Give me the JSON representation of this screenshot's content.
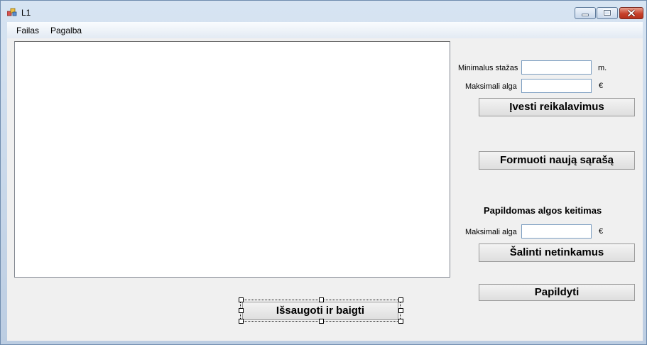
{
  "window": {
    "title": "L1",
    "controls": [
      "minimize-icon",
      "maximize-icon",
      "close-icon"
    ]
  },
  "menu": {
    "items": [
      "Failas",
      "Pagalba"
    ]
  },
  "requirements": {
    "min_experience_label": "Minimalus stažas",
    "min_experience_value": "",
    "min_experience_unit": "m.",
    "max_salary_label": "Maksimali alga",
    "max_salary_value": "",
    "max_salary_unit": "€",
    "enter_button": "Įvesti reikalavimus"
  },
  "form_list_button": "Formuoti naują sąrašą",
  "salary_change": {
    "heading": "Papildomas algos keitimas",
    "max_salary_label": "Maksimali alga",
    "max_salary_value": "",
    "max_salary_unit": "€",
    "remove_button": "Šalinti netinkamus"
  },
  "supplement_button": "Papildyti",
  "save_exit_button": "Išsaugoti ir baigti",
  "colors": {
    "close_button": "#c7412b",
    "border": "#6f8cae"
  }
}
